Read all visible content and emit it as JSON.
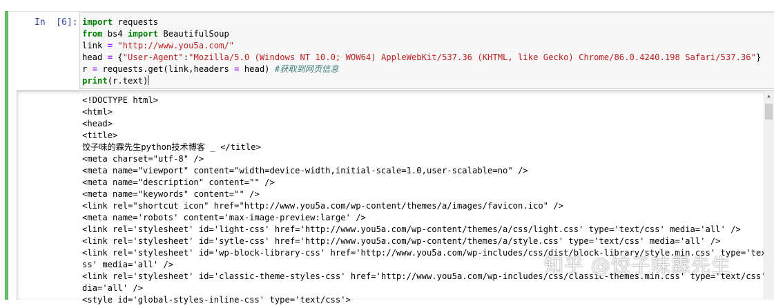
{
  "cell": {
    "prompt": "In  [6]:",
    "code_lines": [
      [
        {
          "t": "import",
          "c": "kw"
        },
        {
          "t": " requests",
          "c": ""
        }
      ],
      [
        {
          "t": "from",
          "c": "kw"
        },
        {
          "t": " bs4 ",
          "c": ""
        },
        {
          "t": "import",
          "c": "kw"
        },
        {
          "t": " BeautifulSoup",
          "c": ""
        }
      ],
      [
        {
          "t": "link ",
          "c": ""
        },
        {
          "t": "=",
          "c": "op"
        },
        {
          "t": " ",
          "c": ""
        },
        {
          "t": "\"http://www.you5a.com/\"",
          "c": "str"
        }
      ],
      [
        {
          "t": "head ",
          "c": ""
        },
        {
          "t": "=",
          "c": "op"
        },
        {
          "t": " {",
          "c": ""
        },
        {
          "t": "\"User-Agent\"",
          "c": "str"
        },
        {
          "t": ":",
          "c": ""
        },
        {
          "t": "\"Mozilla/5.0 (Windows NT 10.0; WOW64) AppleWebKit/537.36 (KHTML, like Gecko) Chrome/86.0.4240.198 Safari/537.36\"",
          "c": "str"
        },
        {
          "t": "}",
          "c": ""
        }
      ],
      [
        {
          "t": "r ",
          "c": ""
        },
        {
          "t": "=",
          "c": "op"
        },
        {
          "t": " requests.get(link,headers ",
          "c": ""
        },
        {
          "t": "=",
          "c": "op"
        },
        {
          "t": " head) ",
          "c": ""
        },
        {
          "t": "#获取到网页信息",
          "c": "cm"
        }
      ],
      [
        {
          "t": "print",
          "c": "kw"
        },
        {
          "t": "(r.text)",
          "c": ""
        }
      ]
    ]
  },
  "output": {
    "lines": [
      "<!DOCTYPE html>",
      "<html>",
      "<head>",
      "<title>",
      "饺子味的霖先生python技术博客 _ </title>",
      "<meta charset=\"utf-8\" />",
      "<meta name=\"viewport\" content=\"width=device-width,initial-scale=1.0,user-scalable=no\" />",
      "<meta name=\"description\" content=\"\" />",
      "<meta name=\"keywords\" content=\"\" />",
      "<link rel=\"shortcut icon\" href=\"http://www.you5a.com/wp-content/themes/a/images/favicon.ico\" />",
      "<meta name='robots' content='max-image-preview:large' />",
      "<link rel='stylesheet' id='light-css' href='http://www.you5a.com/wp-content/themes/a/css/light.css' type='text/css' media='all' />",
      "<link rel='stylesheet' id='sytle-css' href='http://www.you5a.com/wp-content/themes/a/style.css' type='text/css' media='all' />",
      "<link rel='stylesheet' id='wp-block-library-css' href='http://www.you5a.com/wp-includes/css/dist/block-library/style.min.css' type='text/c",
      "ss' media='all' />",
      "<link rel='stylesheet' id='classic-theme-styles-css' href='http://www.you5a.com/wp-includes/css/classic-themes.min.css' type='text/css' me",
      "dia='all' />",
      "<style id='global-styles-inline-css' type='text/css'>"
    ]
  },
  "scrollbar": {
    "up_arrow": "▲"
  },
  "watermark": "知乎 @饺子味霖先生",
  "colors": {
    "selection_bar": "#66bb6a",
    "prompt": "#303f9f",
    "keyword": "#008000",
    "string": "#ba2121",
    "operator": "#aa22ff",
    "comment": "#408080"
  }
}
